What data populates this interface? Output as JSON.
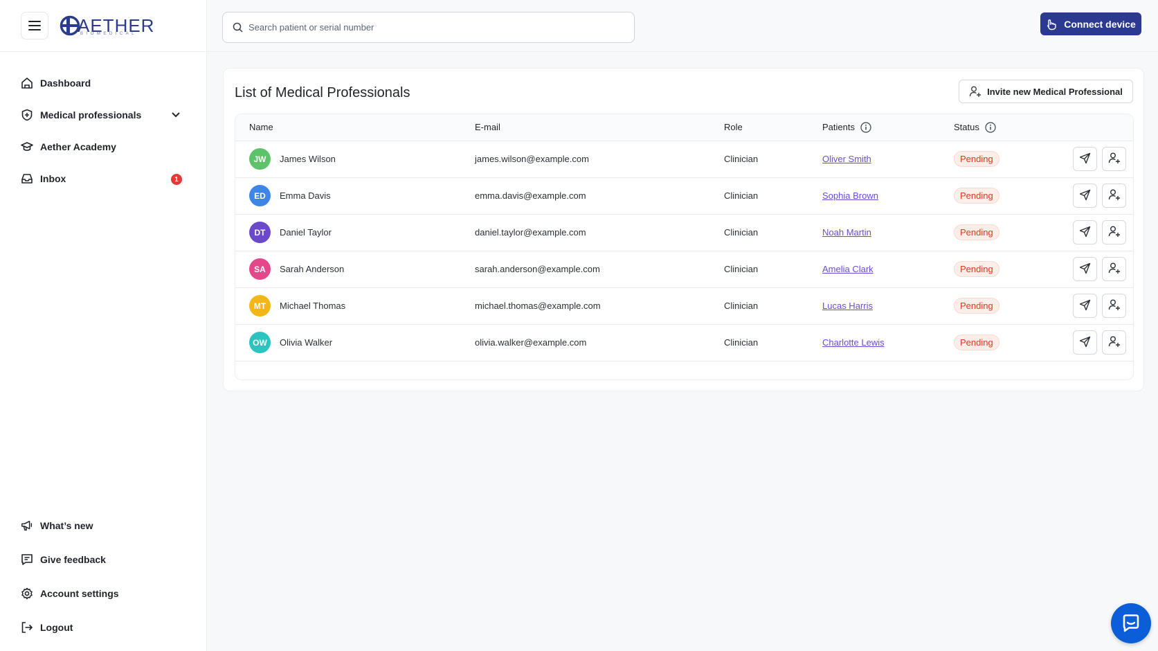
{
  "brand": {
    "name": "AETHER",
    "sub": "BIOMEDICAL"
  },
  "sidebar": {
    "items": [
      {
        "label": "Dashboard",
        "icon": "home-icon"
      },
      {
        "label": "Medical professionals",
        "icon": "shield-plus-icon",
        "expandable": true
      },
      {
        "label": "Aether Academy",
        "icon": "graduation-cap-icon"
      },
      {
        "label": "Inbox",
        "icon": "inbox-icon",
        "badge": "1"
      }
    ],
    "bottom_items": [
      {
        "label": "What’s new",
        "icon": "megaphone-icon"
      },
      {
        "label": "Give feedback",
        "icon": "feedback-icon"
      },
      {
        "label": "Account settings",
        "icon": "gear-icon"
      },
      {
        "label": "Logout",
        "icon": "logout-icon"
      }
    ]
  },
  "header": {
    "search_placeholder": "Search patient or serial number",
    "connect_label": "Connect device"
  },
  "main": {
    "title": "List of Medical Professionals",
    "invite_label": "Invite new Medical Professional",
    "columns": [
      "Name",
      "E-mail",
      "Role",
      "Patients",
      "Status"
    ],
    "rows": [
      {
        "initials": "JW",
        "color": "#5cc36b",
        "name": "James Wilson",
        "email": "james.wilson@example.com",
        "role": "Clinician",
        "patient": "Oliver Smith",
        "status": "Pending"
      },
      {
        "initials": "ED",
        "color": "#3d86e8",
        "name": "Emma Davis",
        "email": "emma.davis@example.com",
        "role": "Clinician",
        "patient": "Sophia Brown",
        "status": "Pending"
      },
      {
        "initials": "DT",
        "color": "#6b4ac9",
        "name": "Daniel Taylor",
        "email": "daniel.taylor@example.com",
        "role": "Clinician",
        "patient": "Noah Martin",
        "status": "Pending"
      },
      {
        "initials": "SA",
        "color": "#e5488a",
        "name": "Sarah Anderson",
        "email": "sarah.anderson@example.com",
        "role": "Clinician",
        "patient": "Amelia Clark",
        "status": "Pending"
      },
      {
        "initials": "MT",
        "color": "#f2b619",
        "name": "Michael Thomas",
        "email": "michael.thomas@example.com",
        "role": "Clinician",
        "patient": "Lucas Harris",
        "status": "Pending"
      },
      {
        "initials": "OW",
        "color": "#2cc4bf",
        "name": "Olivia Walker",
        "email": "olivia.walker@example.com",
        "role": "Clinician",
        "patient": "Charlotte Lewis",
        "status": "Pending"
      }
    ]
  },
  "colors": {
    "accent": "#2b3990",
    "pending_text": "#d93a1f",
    "link": "#6a4bd6",
    "chat": "#0b5ed7"
  }
}
